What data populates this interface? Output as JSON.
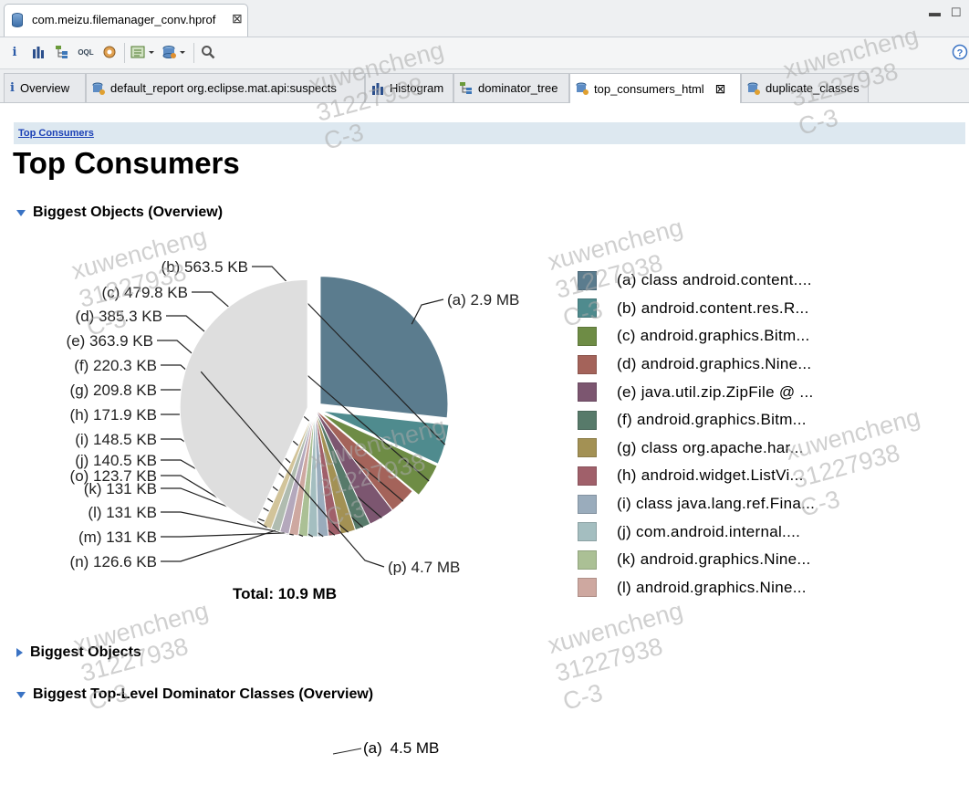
{
  "editor_tab": {
    "label": "com.meizu.filemanager_conv.hprof"
  },
  "view_tabs": [
    {
      "label": "Overview"
    },
    {
      "label": "default_report  org.eclipse.mat.api:suspects"
    },
    {
      "label": "Histogram"
    },
    {
      "label": "dominator_tree"
    },
    {
      "label": "top_consumers_html"
    },
    {
      "label": "duplicate_classes"
    }
  ],
  "toolbar_icons": [
    "info-icon",
    "histogram-icon",
    "dominator-tree-icon",
    "oql-icon",
    "heap-dump-overview-icon",
    "run-report-icon",
    "query-browser-icon",
    "search-icon",
    "help-icon"
  ],
  "breadcrumb": "Top Consumers",
  "page_title": "Top Consumers",
  "sections": {
    "biggest_objects_overview": "Biggest Objects (Overview)",
    "biggest_objects": "Biggest Objects",
    "dominator_classes_overview": "Biggest Top-Level Dominator Classes (Overview)"
  },
  "total": "Total: 10.9 MB",
  "chart_data": {
    "type": "pie",
    "slices": [
      {
        "key": "(a)",
        "value_label": "2.9 MB",
        "value_kb": 2969.6,
        "legend": "class android.content....",
        "color": "#5b7c8e"
      },
      {
        "key": "(b)",
        "value_label": "563.5 KB",
        "value_kb": 563.5,
        "legend": "android.content.res.R...",
        "color": "#4f8b8e"
      },
      {
        "key": "(c)",
        "value_label": "479.8 KB",
        "value_kb": 479.8,
        "legend": "android.graphics.Bitm...",
        "color": "#6e8c45"
      },
      {
        "key": "(d)",
        "value_label": "385.3 KB",
        "value_kb": 385.3,
        "legend": "android.graphics.Nine...",
        "color": "#a4635a"
      },
      {
        "key": "(e)",
        "value_label": "363.9 KB",
        "value_kb": 363.9,
        "legend": "java.util.zip.ZipFile @ ...",
        "color": "#7c5670"
      },
      {
        "key": "(f)",
        "value_label": "220.3 KB",
        "value_kb": 220.3,
        "legend": "android.graphics.Bitm...",
        "color": "#577a6a"
      },
      {
        "key": "(g)",
        "value_label": "209.8 KB",
        "value_kb": 209.8,
        "legend": "class org.apache.har...",
        "color": "#a39154"
      },
      {
        "key": "(h)",
        "value_label": "171.9 KB",
        "value_kb": 171.9,
        "legend": "android.widget.ListVi...",
        "color": "#a0606a"
      },
      {
        "key": "(i)",
        "value_label": "148.5 KB",
        "value_kb": 148.5,
        "legend": "class java.lang.ref.Fina...",
        "color": "#9aacbc"
      },
      {
        "key": "(j)",
        "value_label": "140.5 KB",
        "value_kb": 140.5,
        "legend": "com.android.internal....",
        "color": "#a4bec0"
      },
      {
        "key": "(k)",
        "value_label": "131 KB",
        "value_kb": 131,
        "legend": "android.graphics.Nine...",
        "color": "#abc095"
      },
      {
        "key": "(l)",
        "value_label": "131 KB",
        "value_kb": 131,
        "legend": "android.graphics.Nine...",
        "color": "#cea8a0"
      },
      {
        "key": "(m)",
        "value_label": "131 KB",
        "value_kb": 131,
        "color": "#b4a8bc"
      },
      {
        "key": "(n)",
        "value_label": "126.6 KB",
        "value_kb": 126.6,
        "color": "#b0bcb0"
      },
      {
        "key": "(o)",
        "value_label": "123.7 KB",
        "value_kb": 123.7,
        "color": "#d2c49a"
      },
      {
        "key": "(p)",
        "value_label": "4.7 MB",
        "value_kb": 4812.8,
        "color": "#dedede"
      }
    ]
  },
  "second_chart_first_label": {
    "key": "(a)",
    "value_label": "4.5 MB"
  },
  "watermark": [
    "xuwencheng",
    "31227938",
    "C-3"
  ]
}
